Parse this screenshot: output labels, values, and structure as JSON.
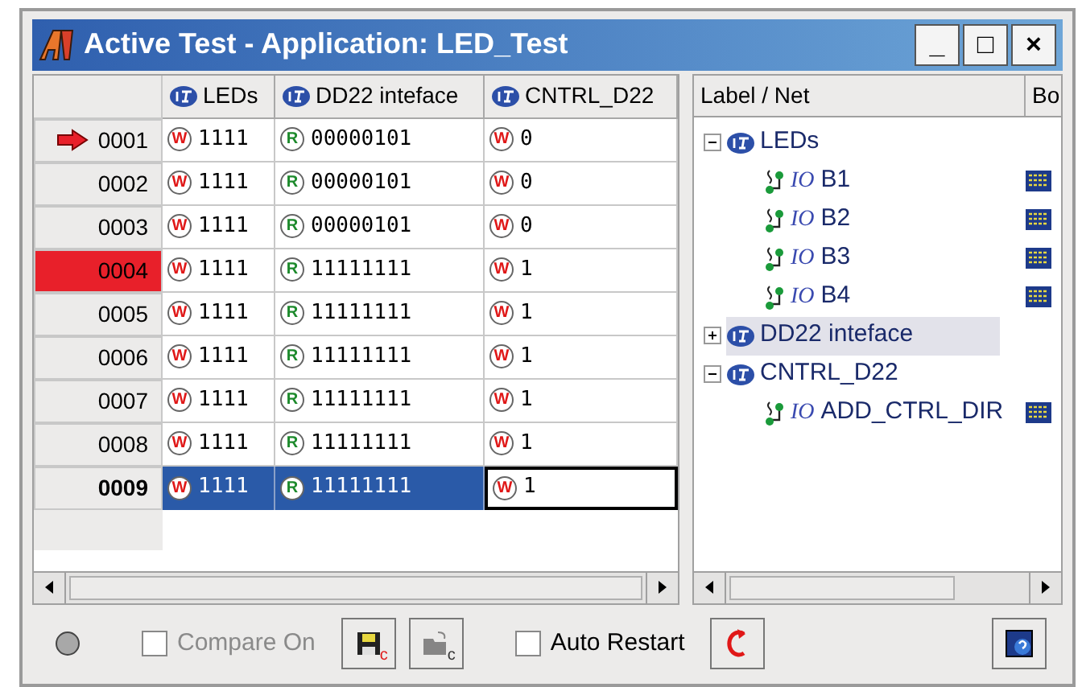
{
  "window": {
    "title": "Active Test - Application: LED_Test",
    "controls": [
      "_",
      "□",
      "×"
    ]
  },
  "grid": {
    "columns": [
      "LEDs",
      "DD22 inteface",
      "CNTRL_D22"
    ],
    "rows": [
      {
        "step": "0001",
        "current": true,
        "failed": false,
        "selected": false,
        "cells": [
          {
            "mode": "W",
            "value": "1111"
          },
          {
            "mode": "R",
            "value": "00000101"
          },
          {
            "mode": "W",
            "value": "0"
          }
        ]
      },
      {
        "step": "0002",
        "current": false,
        "failed": false,
        "selected": false,
        "cells": [
          {
            "mode": "W",
            "value": "1111"
          },
          {
            "mode": "R",
            "value": "00000101"
          },
          {
            "mode": "W",
            "value": "0"
          }
        ]
      },
      {
        "step": "0003",
        "current": false,
        "failed": false,
        "selected": false,
        "cells": [
          {
            "mode": "W",
            "value": "1111"
          },
          {
            "mode": "R",
            "value": "00000101"
          },
          {
            "mode": "W",
            "value": "0"
          }
        ]
      },
      {
        "step": "0004",
        "current": false,
        "failed": true,
        "selected": false,
        "cells": [
          {
            "mode": "W",
            "value": "1111"
          },
          {
            "mode": "R",
            "value": "11111111"
          },
          {
            "mode": "W",
            "value": "1"
          }
        ]
      },
      {
        "step": "0005",
        "current": false,
        "failed": false,
        "selected": false,
        "cells": [
          {
            "mode": "W",
            "value": "1111"
          },
          {
            "mode": "R",
            "value": "11111111"
          },
          {
            "mode": "W",
            "value": "1"
          }
        ]
      },
      {
        "step": "0006",
        "current": false,
        "failed": false,
        "selected": false,
        "cells": [
          {
            "mode": "W",
            "value": "1111"
          },
          {
            "mode": "R",
            "value": "11111111"
          },
          {
            "mode": "W",
            "value": "1"
          }
        ]
      },
      {
        "step": "0007",
        "current": false,
        "failed": false,
        "selected": false,
        "cells": [
          {
            "mode": "W",
            "value": "1111"
          },
          {
            "mode": "R",
            "value": "11111111"
          },
          {
            "mode": "W",
            "value": "1"
          }
        ]
      },
      {
        "step": "0008",
        "current": false,
        "failed": false,
        "selected": false,
        "cells": [
          {
            "mode": "W",
            "value": "1111"
          },
          {
            "mode": "R",
            "value": "11111111"
          },
          {
            "mode": "W",
            "value": "1"
          }
        ]
      },
      {
        "step": "0009",
        "current": false,
        "failed": false,
        "selected": true,
        "cells": [
          {
            "mode": "W",
            "value": "1111"
          },
          {
            "mode": "R",
            "value": "11111111"
          },
          {
            "mode": "W",
            "value": "1"
          }
        ]
      }
    ]
  },
  "tree": {
    "columns": [
      "Label / Net",
      "Bo"
    ],
    "items": [
      {
        "label": "LEDs",
        "expanded": true,
        "selected": false,
        "children": [
          {
            "tag": "IO",
            "label": "B1"
          },
          {
            "tag": "IO",
            "label": "B2"
          },
          {
            "tag": "IO",
            "label": "B3"
          },
          {
            "tag": "IO",
            "label": "B4"
          }
        ]
      },
      {
        "label": "DD22 inteface",
        "expanded": false,
        "selected": true
      },
      {
        "label": "CNTRL_D22",
        "expanded": true,
        "selected": false,
        "children": [
          {
            "tag": "IO",
            "label": "ADD_CTRL_DIR"
          }
        ]
      }
    ]
  },
  "toolbar": {
    "compare_on": {
      "label": "Compare On",
      "checked": false,
      "disabled": true
    },
    "save_button": {
      "badge": "c"
    },
    "open_button": {
      "badge": "c",
      "disabled": true
    },
    "auto_restart": {
      "label": "Auto Restart",
      "checked": false
    }
  }
}
